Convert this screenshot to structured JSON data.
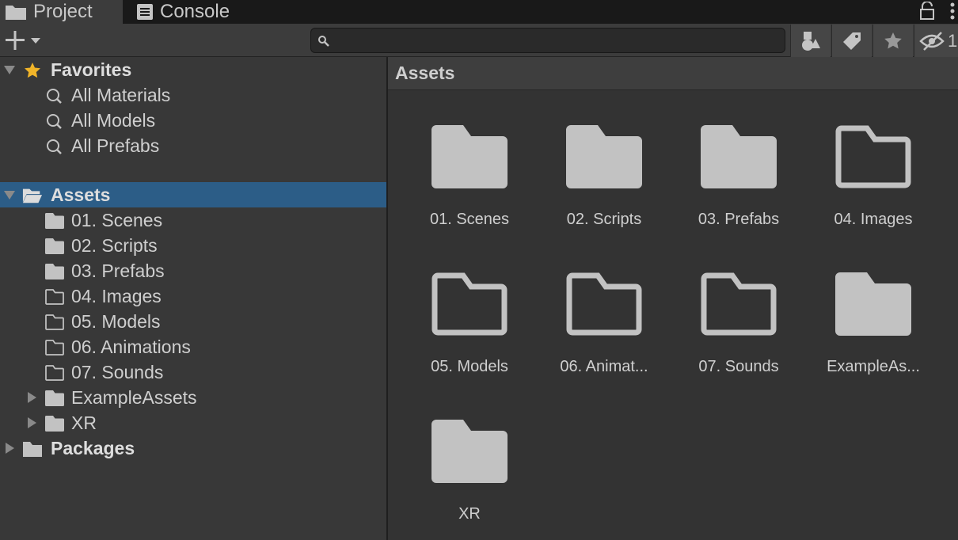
{
  "tabs": [
    {
      "label": "Project",
      "icon": "folder-icon"
    },
    {
      "label": "Console",
      "icon": "console-icon"
    }
  ],
  "toolbar": {
    "add_icon": "plus-icon",
    "search": {
      "placeholder": "",
      "value": ""
    },
    "hidden_count": "1"
  },
  "tree": {
    "favorites": {
      "label": "Favorites",
      "items": [
        "All Materials",
        "All Models",
        "All Prefabs"
      ]
    },
    "assets": {
      "label": "Assets",
      "children": [
        {
          "label": "01. Scenes",
          "filled": true
        },
        {
          "label": "02. Scripts",
          "filled": true
        },
        {
          "label": "03. Prefabs",
          "filled": true
        },
        {
          "label": "04. Images",
          "filled": false
        },
        {
          "label": "05. Models",
          "filled": false
        },
        {
          "label": "06. Animations",
          "filled": false
        },
        {
          "label": "07. Sounds",
          "filled": false
        },
        {
          "label": "ExampleAssets",
          "filled": true,
          "expandable": true
        },
        {
          "label": "XR",
          "filled": true,
          "expandable": true
        }
      ]
    },
    "packages": {
      "label": "Packages"
    }
  },
  "grid": {
    "header": "Assets",
    "items": [
      {
        "label": "01. Scenes",
        "filled": true
      },
      {
        "label": "02. Scripts",
        "filled": true
      },
      {
        "label": "03. Prefabs",
        "filled": true
      },
      {
        "label": "04. Images",
        "filled": false
      },
      {
        "label": "05. Models",
        "filled": false
      },
      {
        "label": "06. Animat...",
        "filled": false
      },
      {
        "label": "07. Sounds",
        "filled": false
      },
      {
        "label": "ExampleAs...",
        "filled": true
      },
      {
        "label": "XR",
        "filled": true
      }
    ]
  },
  "colors": {
    "selection": "#2c5d87",
    "star": "#f0b429",
    "folder": "#c2c2c2"
  }
}
